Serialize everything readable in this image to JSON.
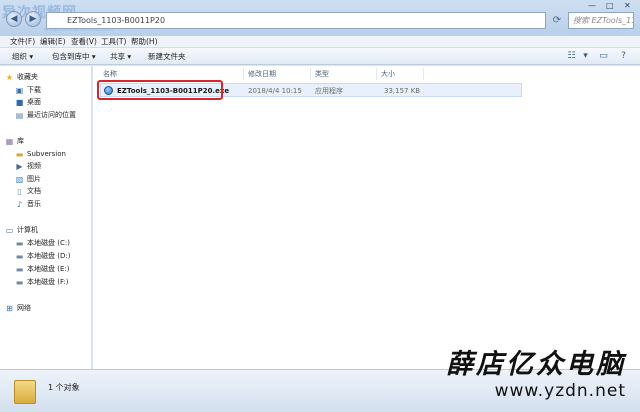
{
  "window": {
    "watermark_title": "异次视频网",
    "watermark_url": "www.runbenetd60.com",
    "address_path": "EZTools_1103-B0011P20",
    "search_placeholder": "搜索 EZTools_1103-...",
    "controls": {
      "minimize": "—",
      "maximize": "□",
      "close": "✕"
    }
  },
  "menu": [
    {
      "label": "文件(F)"
    },
    {
      "label": "编辑(E)"
    },
    {
      "label": "查看(V)"
    },
    {
      "label": "工具(T)"
    },
    {
      "label": "帮助(H)"
    }
  ],
  "toolbar": {
    "organize": "组织 ▾",
    "include_in_library": "包含到库中 ▾",
    "share": "共享 ▾",
    "new_folder": "新建文件夹"
  },
  "nav": {
    "favorites": "收藏夹",
    "downloads": "下载",
    "desktop": "桌面",
    "recent": "最近访问的位置",
    "libraries": "库",
    "subversion": "Subversion",
    "videos": "视频",
    "pictures": "图片",
    "documents": "文档",
    "music": "音乐",
    "computer": "计算机",
    "drive_c": "本地磁盘 (C:)",
    "drive_d": "本地磁盘 (D:)",
    "drive_e": "本地磁盘 (E:)",
    "drive_f": "本地磁盘 (F:)",
    "network": "网络"
  },
  "columns": {
    "name": "名称",
    "date": "修改日期",
    "type": "类型",
    "size": "大小"
  },
  "files": [
    {
      "name": "EZTools_1103-B0011P20.exe",
      "date": "2018/4/4 10:15",
      "type": "应用程序",
      "size": "33,157 KB"
    }
  ],
  "status": {
    "count": "1 个对象"
  },
  "brand": {
    "name": "薛店亿众电脑",
    "url": "www.yzdn.net"
  },
  "colors": {
    "highlight": "#d8262c",
    "selected_row": "#e8f1fb"
  }
}
